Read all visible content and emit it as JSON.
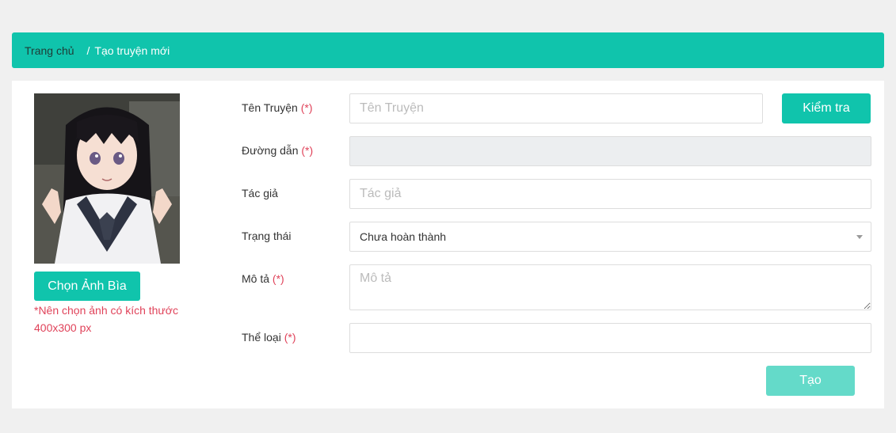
{
  "breadcrumb": {
    "home": "Trang chủ",
    "separator": "/",
    "current": "Tạo truyện mới"
  },
  "cover": {
    "choose_label": "Chọn Ảnh Bìa",
    "hint": "*Nên chọn ảnh có kích thước 400x300 px"
  },
  "required_mark": "(*)",
  "form": {
    "title": {
      "label": "Tên Truyện",
      "placeholder": "Tên Truyện",
      "value": ""
    },
    "check_label": "Kiểm tra",
    "slug": {
      "label": "Đường dẫn",
      "value": ""
    },
    "author": {
      "label": "Tác giả",
      "placeholder": "Tác giả",
      "value": ""
    },
    "status": {
      "label": "Trạng thái",
      "selected": "Chưa hoàn thành"
    },
    "description": {
      "label": "Mô tả",
      "placeholder": "Mô tả"
    },
    "genre": {
      "label": "Thể loại",
      "value": ""
    },
    "submit_label": "Tạo"
  },
  "colors": {
    "accent": "#10c4ac",
    "accent_disabled": "#64dac9",
    "required": "#e0435a"
  }
}
